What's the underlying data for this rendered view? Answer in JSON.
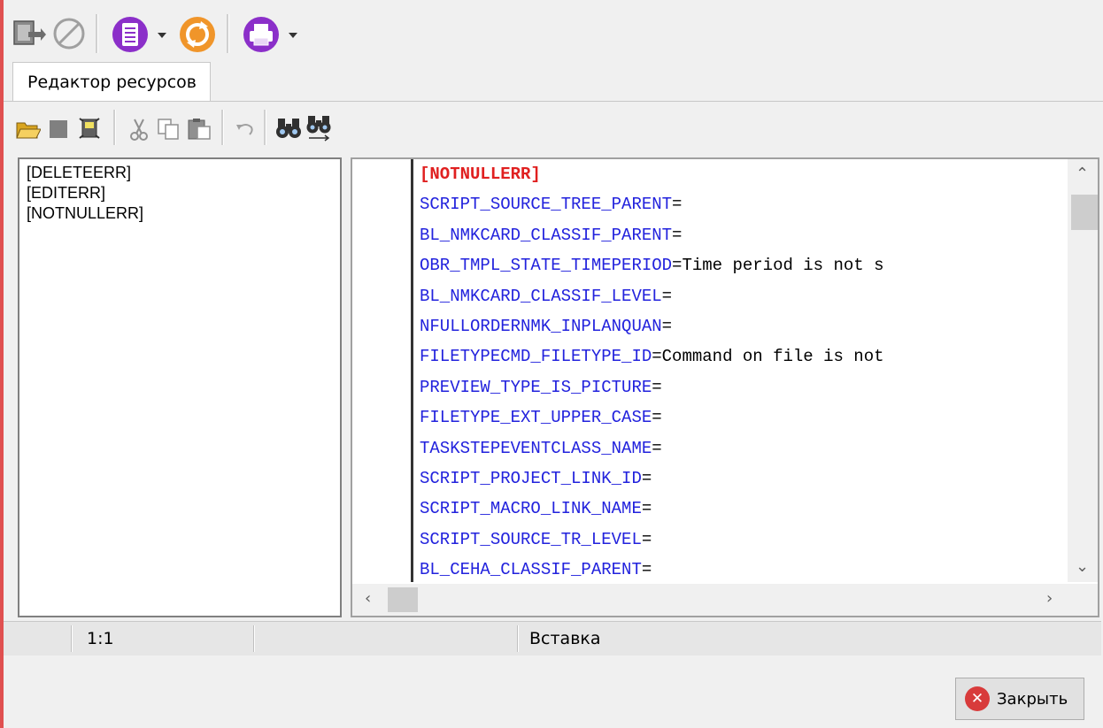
{
  "colors": {
    "accent_red": "#e02020",
    "key_blue": "#2222dd",
    "value_black": "#000000",
    "toolbar_purple": "#8b2fc9",
    "toolbar_orange": "#f0952a"
  },
  "main_toolbar": {
    "buttons": [
      {
        "name": "exit-icon"
      },
      {
        "name": "cancel-icon"
      },
      {
        "name": "document-icon",
        "has_dropdown": true
      },
      {
        "name": "refresh-icon"
      },
      {
        "name": "print-icon",
        "has_dropdown": true
      }
    ]
  },
  "tabs": [
    {
      "label": "Редактор ресурсов"
    }
  ],
  "editor_toolbar": {
    "buttons": [
      "open-folder-icon",
      "stop-icon",
      "save-icon",
      "cut-icon",
      "copy-icon",
      "paste-icon",
      "undo-icon",
      "find-icon",
      "replace-icon"
    ]
  },
  "tree": {
    "items": [
      "[DELETEERR]",
      "[EDITERR]",
      "[NOTNULLERR]"
    ]
  },
  "code": {
    "section": "[NOTNULLERR]",
    "lines": [
      {
        "key": "SCRIPT_SOURCE_TREE_PARENT",
        "sep": "=",
        "value": ""
      },
      {
        "key": "BL_NMKCARD_CLASSIF_PARENT",
        "sep": "=",
        "value": ""
      },
      {
        "key": "OBR_TMPL_STATE_TIMEPERIOD",
        "sep": "=",
        "value": "Time period is not s"
      },
      {
        "key": "BL_NMKCARD_CLASSIF_LEVEL",
        "sep": "=",
        "value": ""
      },
      {
        "key": "NFULLORDERNMK_INPLANQUAN",
        "sep": "=",
        "value": ""
      },
      {
        "key": "FILETYPECMD_FILETYPE_ID",
        "sep": "=",
        "value": "Command on file is not"
      },
      {
        "key": "PREVIEW_TYPE_IS_PICTURE",
        "sep": "=",
        "value": ""
      },
      {
        "key": "FILETYPE_EXT_UPPER_CASE",
        "sep": "=",
        "value": ""
      },
      {
        "key": "TASKSTEPEVENTCLASS_NAME",
        "sep": "=",
        "value": ""
      },
      {
        "key": "SCRIPT_PROJECT_LINK_ID",
        "sep": "=",
        "value": ""
      },
      {
        "key": "SCRIPT_MACRO_LINK_NAME",
        "sep": "=",
        "value": ""
      },
      {
        "key": "SCRIPT_SOURCE_TR_LEVEL",
        "sep": "=",
        "value": ""
      },
      {
        "key": "BL_CEHA_CLASSIF_PARENT",
        "sep": "=",
        "value": ""
      }
    ]
  },
  "status": {
    "position": "1:1",
    "mode": "Вставка"
  },
  "footer": {
    "close_label": "Закрыть",
    "close_icon": "close-circle-icon"
  }
}
